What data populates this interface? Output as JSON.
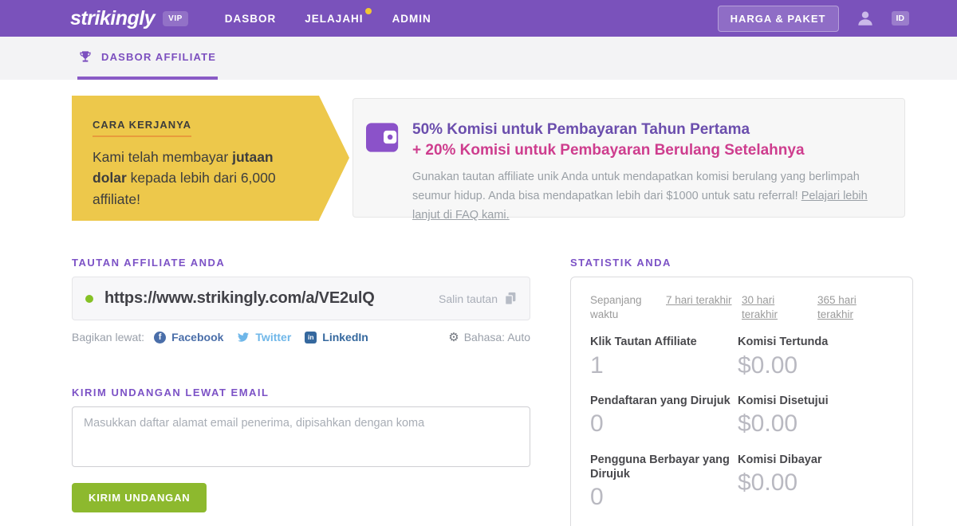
{
  "navbar": {
    "logo": "strikingly",
    "vip_badge": "VIP",
    "items": [
      {
        "label": "DASBOR",
        "has_dot": false
      },
      {
        "label": "JELAJAHI",
        "has_dot": true
      },
      {
        "label": "ADMIN",
        "has_dot": false
      }
    ],
    "pricing_button": "HARGA & PAKET",
    "locale_badge": "ID"
  },
  "subnav": {
    "tab": "DASBOR AFFILIATE"
  },
  "banner": {
    "kicker": "CARA KERJANYA",
    "body_prefix": "Kami telah membayar ",
    "body_bold": "jutaan dolar",
    "body_suffix": " kepada lebih dari 6,000 affiliate!"
  },
  "promo": {
    "heading_line1": "50% Komisi untuk Pembayaran Tahun Pertama",
    "heading_line2": "+ 20% Komisi untuk Pembayaran Berulang Setelahnya",
    "body": "Gunakan tautan affiliate unik Anda untuk mendapatkan komisi berulang yang berlimpah seumur hidup. Anda bisa mendapatkan lebih dari $1000 untuk satu referral! ",
    "faq_link": "Pelajari lebih lanjut di FAQ kami."
  },
  "affiliate_link": {
    "title": "TAUTAN AFFILIATE ANDA",
    "url": "https://www.strikingly.com/a/VE2ulQ",
    "copy_label": "Salin tautan",
    "share_label": "Bagikan lewat:",
    "social": [
      {
        "name": "Facebook"
      },
      {
        "name": "Twitter"
      },
      {
        "name": "LinkedIn"
      }
    ],
    "linkedin_icon_text": "in",
    "facebook_icon_text": "f",
    "language_label": "Bahasa: Auto",
    "gear_glyph": "⚙"
  },
  "email_invite": {
    "title": "KIRIM UNDANGAN LEWAT EMAIL",
    "placeholder": "Masukkan daftar alamat email penerima, dipisahkan dengan koma",
    "value": "",
    "button": "KIRIM UNDANGAN"
  },
  "stats": {
    "title": "STATISTIK ANDA",
    "periods": [
      {
        "label": "Sepanjang waktu",
        "active": true
      },
      {
        "label": "7 hari terakhir",
        "active": false
      },
      {
        "label": "30 hari terakhir",
        "active": false
      },
      {
        "label": "365 hari terakhir",
        "active": false
      }
    ],
    "items": [
      {
        "label": "Klik Tautan Affiliate",
        "value": "1"
      },
      {
        "label": "Komisi Tertunda",
        "value": "$0.00"
      },
      {
        "label": "Pendaftaran yang Dirujuk",
        "value": "0"
      },
      {
        "label": "Komisi Disetujui",
        "value": "$0.00"
      },
      {
        "label": "Pengguna Berbayar yang Dirujuk",
        "value": "0"
      },
      {
        "label": "Komisi Dibayar",
        "value": "$0.00"
      }
    ]
  },
  "colors": {
    "navbar_purple": "#7a52bb",
    "accent_purple": "#7c52c6",
    "heading_purple": "#6b4ead",
    "heading_pink": "#ce3d8e",
    "ribbon_yellow": "#edc84b",
    "kicker_underline_orange": "#e89b3c",
    "button_green": "#8db92e",
    "status_dot_green": "#85c125",
    "notification_dot_yellow": "#f2c832"
  }
}
